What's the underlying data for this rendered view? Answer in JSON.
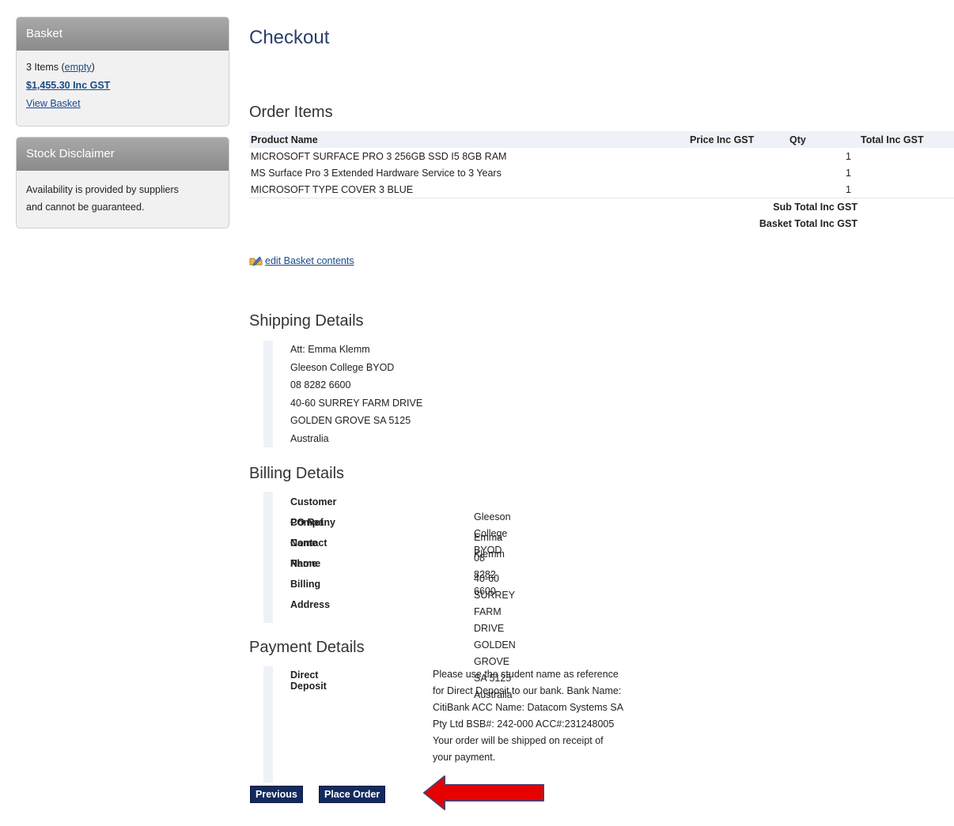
{
  "basket": {
    "title": "Basket",
    "items_text": "3 Items (",
    "empty_link": "empty",
    "close_paren": ")",
    "total_link": "$1,455.30 Inc GST",
    "view_link": "View Basket"
  },
  "disclaimer": {
    "title": "Stock Disclaimer",
    "line1": "Availability is provided by suppliers",
    "line2": "and cannot be guaranteed."
  },
  "page": {
    "title": "Checkout"
  },
  "order_items": {
    "heading": "Order Items",
    "columns": [
      "Product Name",
      "Price Inc GST",
      "Qty",
      "Total Inc GST"
    ],
    "rows": [
      {
        "name": "MICROSOFT SURFACE PRO 3 256GB SSD I5 8GB RAM",
        "qty": "1"
      },
      {
        "name": "MS Surface Pro 3 Extended Hardware Service to 3 Years",
        "qty": "1"
      },
      {
        "name": "MICROSOFT TYPE COVER 3 BLUE",
        "qty": "1"
      }
    ],
    "subtotal_label": "Sub Total Inc GST",
    "basket_total_label": "Basket Total Inc GST",
    "edit_link": "edit Basket contents"
  },
  "shipping": {
    "heading": "Shipping Details",
    "lines": [
      "Att: Emma Klemm",
      "Gleeson College BYOD",
      "08 8282 6600",
      "40-60 SURREY FARM DRIVE",
      "GOLDEN GROVE SA 5125",
      "Australia"
    ]
  },
  "billing": {
    "heading": "Billing Details",
    "po_label": "Customer PO Ref",
    "company_label": "Company Name",
    "company_value": "Gleeson College BYOD",
    "contact_label": "Contact Name",
    "contact_value": "Emma Klemm",
    "phone_label": "Phone",
    "phone_value": "08 8282 6600",
    "address_label": "Billing Address",
    "address_lines": [
      "40-60 SURREY FARM DRIVE",
      "GOLDEN GROVE SA 5125",
      "Australia"
    ]
  },
  "payment": {
    "heading": "Payment Details",
    "method": "Direct Deposit",
    "lines": [
      "Please use the student name as reference",
      "for Direct Deposit to our bank. Bank Name:",
      "CitiBank ACC Name: Datacom Systems SA",
      "Pty Ltd BSB#: 242-000 ACC#:231248005",
      "Your order will be shipped on receipt of",
      "your payment."
    ]
  },
  "buttons": {
    "previous": "Previous",
    "place_order": "Place Order"
  },
  "colors": {
    "button_bg": "#132a5e",
    "arrow": "#e60000"
  }
}
